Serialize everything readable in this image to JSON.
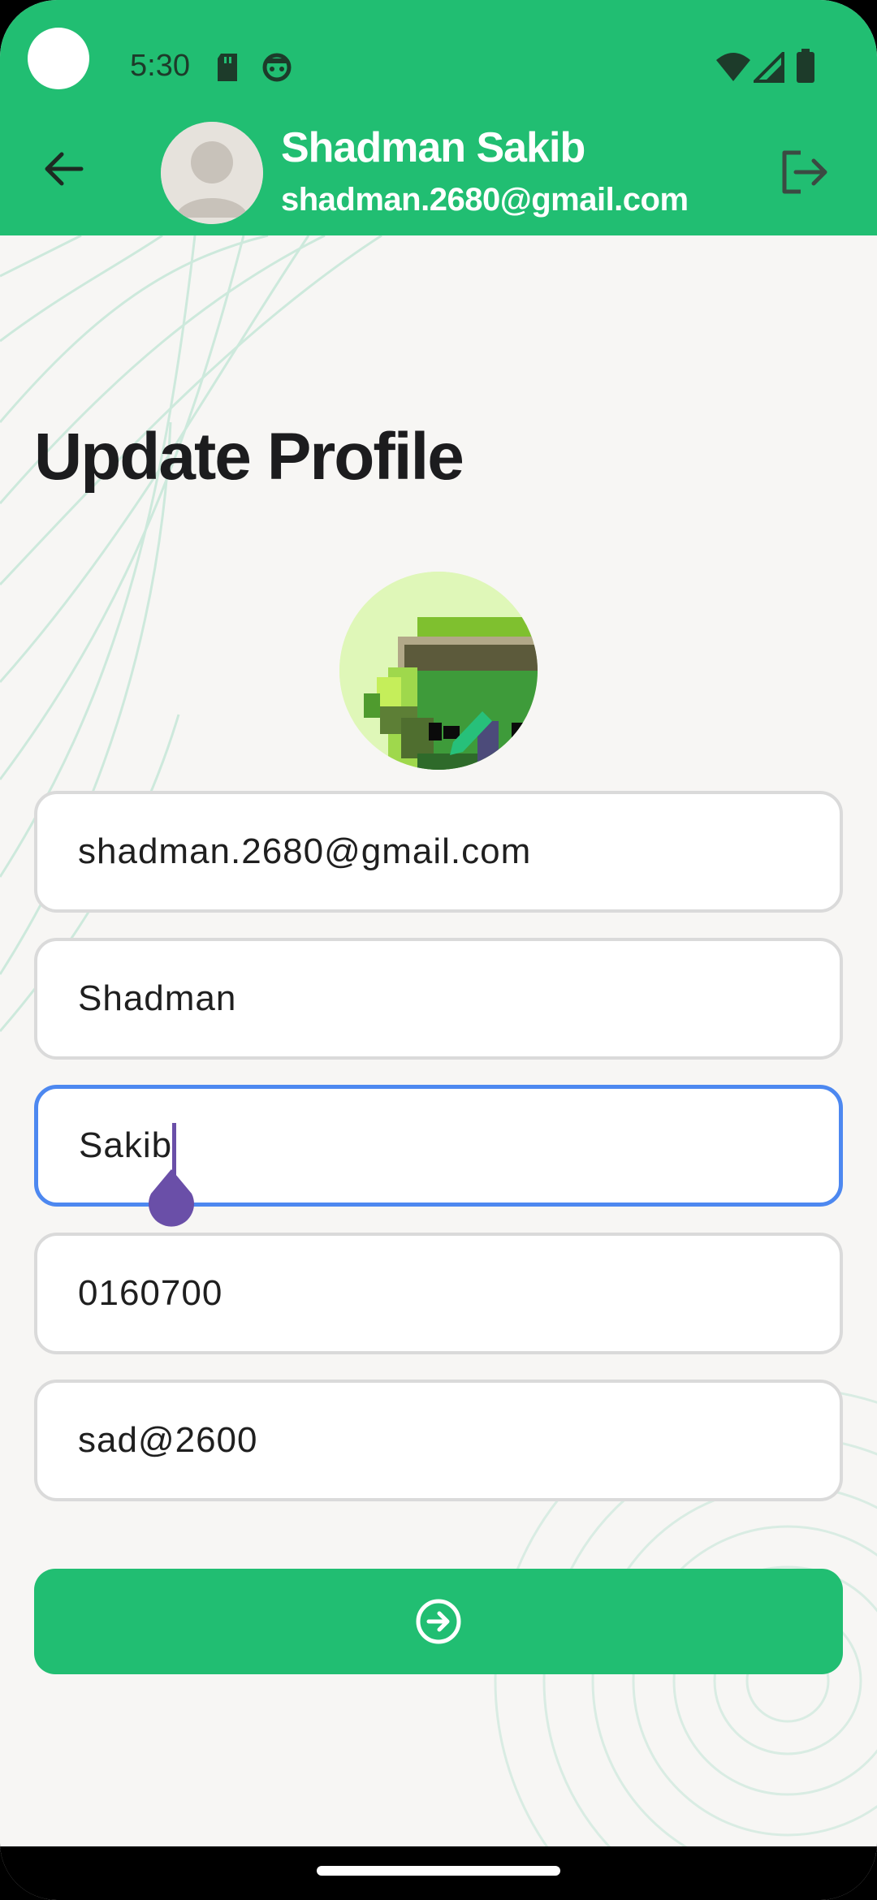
{
  "status_bar": {
    "time": "5:30",
    "icons": [
      "sd-card-icon",
      "android-face-icon",
      "wifi-icon",
      "signal-icon",
      "battery-icon"
    ]
  },
  "header": {
    "back_icon": "arrow-left-icon",
    "avatar_icon": "person-placeholder-icon",
    "name": "Shadman Sakib",
    "email": "shadman.2680@gmail.com",
    "logout_icon": "logout-icon",
    "color": "#21be72"
  },
  "page": {
    "title": "Update Profile",
    "profile_picture_icon": "edit-pencil-icon"
  },
  "form": {
    "email": "shadman.2680@gmail.com",
    "first_name": "Shadman",
    "last_name": "Sakib",
    "phone": "0160700",
    "password": "sad@2600",
    "submit_icon": "arrow-circle-right-icon"
  },
  "colors": {
    "accent": "#21be72",
    "focus_border": "#4d88f0",
    "cursor": "#6a4fa8",
    "background": "#f7f6f4"
  }
}
